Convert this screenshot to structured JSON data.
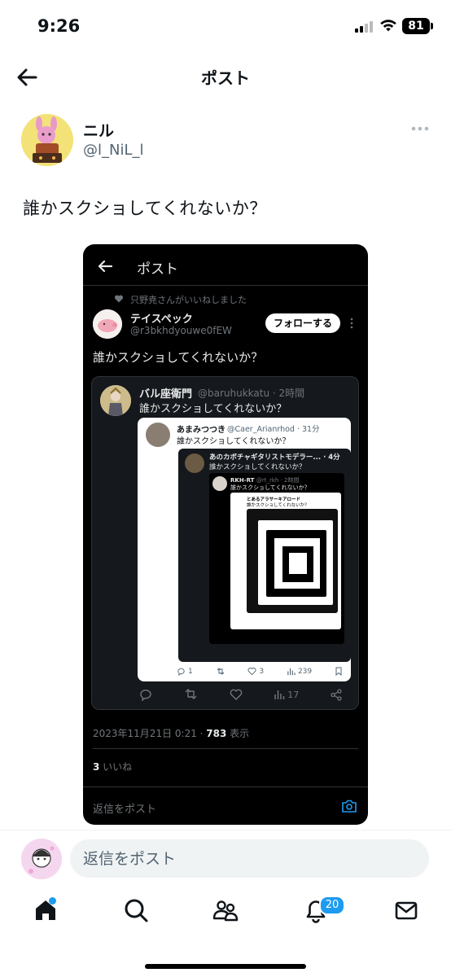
{
  "status": {
    "time": "9:26",
    "battery": "81"
  },
  "header": {
    "title": "ポスト"
  },
  "post": {
    "author_name": "ニル",
    "author_handle": "@l_NiL_l",
    "text": "誰かスクショしてくれないか？"
  },
  "embed": {
    "title": "ポスト",
    "liked_by": "只野尭さんがいいねしました",
    "name": "テイスペック",
    "handle": "@r3bkhdyouwe0fEW",
    "follow_label": "フォローする",
    "text": "誰かスクショしてくれないか？",
    "quote1": {
      "name": "バル座衛門",
      "handle": "@baruhukkatu · 2時間",
      "text": "誰かスクショしてくれないか？",
      "stats": {
        "retweet": "",
        "like": "",
        "views": "17"
      }
    },
    "quote2": {
      "name": "あまみつつき",
      "handle": "@Caer_Arianrhod · 31分",
      "text": "誰かスクショしてくれないか？",
      "stats": {
        "reply": "1",
        "like": "3",
        "views": "239"
      }
    },
    "quote3": {
      "name": "あのカボチャギタリストモデラー... · 4分",
      "text": "誰かスクショしてくれないか？"
    },
    "quote4": {
      "name": "RKH-RT",
      "handle": "@rt_rkh · 2時間",
      "text": "誰かスクショしてくれないか？"
    },
    "quote5": {
      "name": "とあるアラサーキアロード",
      "text": "誰かスクショしてくれないか？"
    },
    "date": "2023年11月21日 0:21 · ",
    "views_count": "783",
    "views_label": " 表示",
    "likes_count": "3",
    "likes_label": " いいね",
    "reply_placeholder": "返信をポスト"
  },
  "reply_bar": {
    "placeholder": "返信をポスト"
  },
  "tabbar": {
    "notifications_badge": "20"
  },
  "colors": {
    "accent": "#1d9bf0",
    "text": "#0f1419",
    "muted": "#536471"
  }
}
